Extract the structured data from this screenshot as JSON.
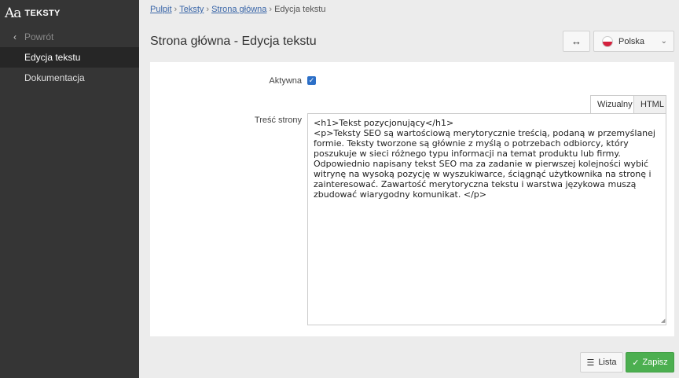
{
  "app": {
    "logo": "Aa",
    "name": "TEKSTY"
  },
  "sidebar": {
    "back_label": "Powrót",
    "items": [
      {
        "label": "Edycja tekstu",
        "active": true
      },
      {
        "label": "Dokumentacja",
        "active": false
      }
    ]
  },
  "breadcrumb": {
    "items": [
      "Pulpit",
      "Teksty",
      "Strona główna"
    ],
    "current": "Edycja tekstu"
  },
  "header": {
    "title": "Strona główna - Edycja tekstu",
    "toggle_icon": "↔",
    "language": "Polska"
  },
  "form": {
    "active_label": "Aktywna",
    "active_checked": true,
    "content_label": "Treść strony",
    "tabs": {
      "visual": "Wizualny",
      "html": "HTML"
    },
    "content": "<h1>Tekst pozycjonujący</h1>\n<p>Teksty SEO są wartościową merytorycznie treścią, podaną w przemyślanej formie. Teksty tworzone są głównie z myślą o potrzebach odbiorcy, który poszukuje w sieci różnego typu informacji na temat produktu lub firmy. Odpowiednio napisany tekst SEO ma za zadanie w pierwszej kolejności wybić witrynę na wysoką pozycję w wyszukiwarce, ściągnąć użytkownika na stronę i zainteresować. Zawartość merytoryczna tekstu i warstwa językowa muszą zbudować wiarygodny komunikat. </p>"
  },
  "footer": {
    "list_label": "Lista",
    "save_label": "Zapisz"
  },
  "colors": {
    "accent": "#2c6fc7",
    "save": "#4caf50",
    "sidebar": "#353535"
  }
}
